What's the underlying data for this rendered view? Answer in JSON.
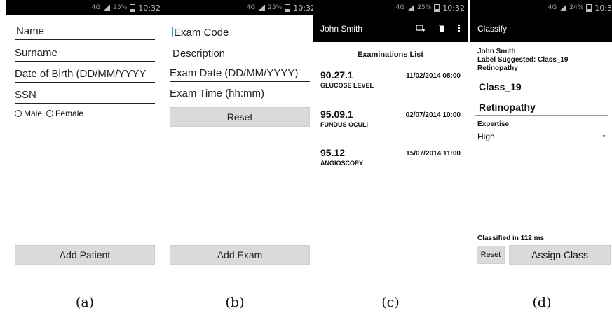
{
  "status": {
    "network": "4G",
    "battery_a": "25%",
    "battery_d": "24%",
    "time": "10:32",
    "time_d": "10:3"
  },
  "panel_a": {
    "fields": [
      "Name",
      "Surname",
      "Date of Birth (DD/MM/YYYY",
      "SSN"
    ],
    "gender": {
      "male": "Male",
      "female": "Female"
    },
    "add_button": "Add Patient",
    "caption": "(a)"
  },
  "panel_b": {
    "fields": [
      "Exam Code",
      "Description",
      "Exam Date (DD/MM/YYYY)",
      "Exam Time (hh:mm)"
    ],
    "reset_button": "Reset",
    "add_button": "Add Exam",
    "caption": "(b)"
  },
  "panel_c": {
    "title": "John Smith",
    "icons": [
      "add-exam-icon",
      "trash-icon",
      "overflow-menu-icon"
    ],
    "list_title": "Examinations List",
    "exams": [
      {
        "code": "90.27.1",
        "name": "GLUCOSE LEVEL",
        "datetime": "11/02/2014 08:00"
      },
      {
        "code": "95.09.1",
        "name": "FUNDUS OCULI",
        "datetime": "02/07/2014 10:00"
      },
      {
        "code": "95.12",
        "name": "ANGIOSCOPY",
        "datetime": "15/07/2014 11:00"
      }
    ],
    "caption": "(c)"
  },
  "panel_d": {
    "title": "Classify",
    "patient": "John Smith",
    "label_suggested": "Label Suggested: Class_19",
    "suggested_name": "Retinopathy",
    "class_field": "Class_19",
    "name_field": "Retinopathy",
    "expertise_label": "Expertise",
    "expertise_value": "High",
    "classified_time": "Classified in 112 ms",
    "reset_button": "Reset",
    "assign_button": "Assign Class",
    "caption": "(d)"
  },
  "colors": {
    "status_bar": "#000000",
    "focus_underline": "#2aa7d8",
    "button": "#dadada"
  }
}
